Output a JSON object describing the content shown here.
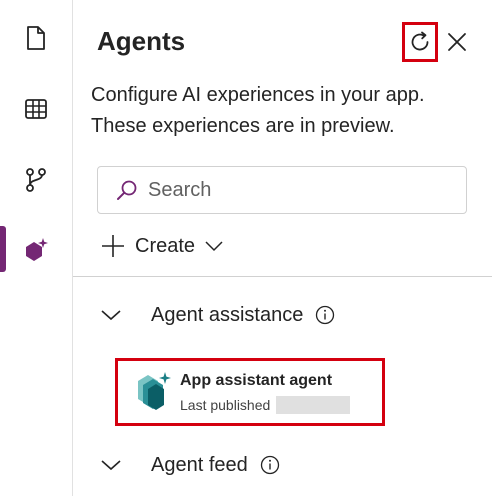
{
  "rail": {
    "items": [
      {
        "name": "pages",
        "icon": "document-icon"
      },
      {
        "name": "data",
        "icon": "table-icon"
      },
      {
        "name": "flows",
        "icon": "branch-icon"
      },
      {
        "name": "agents",
        "icon": "agent-sparkle-icon",
        "active": true
      }
    ],
    "accent": "#742774"
  },
  "panel": {
    "title": "Agents",
    "description": "Configure AI experiences in your app. These experiences are in preview.",
    "search": {
      "placeholder": "Search"
    },
    "create_label": "Create",
    "sections": [
      {
        "label": "Agent assistance",
        "expanded": true,
        "items": [
          {
            "name": "App assistant agent",
            "status_label": "Last published"
          }
        ]
      },
      {
        "label": "Agent feed",
        "expanded": true,
        "items": []
      }
    ]
  },
  "colors": {
    "highlight": "#d4000f",
    "brand_purple": "#742774",
    "text": "#242424"
  }
}
